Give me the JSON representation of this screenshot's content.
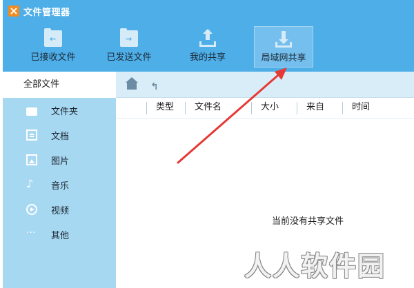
{
  "app": {
    "title": "文件管理器"
  },
  "toolbar": {
    "items": [
      {
        "label": "已接收文件",
        "icon": "received-folder-icon"
      },
      {
        "label": "已发送文件",
        "icon": "sent-folder-icon"
      },
      {
        "label": "我的共享",
        "icon": "upload-share-icon"
      },
      {
        "label": "局域网共享",
        "icon": "download-share-icon",
        "active": true
      }
    ]
  },
  "sidebar": {
    "all_label": "全部文件",
    "items": [
      {
        "label": "文件夹",
        "icon": "folder-icon"
      },
      {
        "label": "文档",
        "icon": "document-icon"
      },
      {
        "label": "图片",
        "icon": "image-icon"
      },
      {
        "label": "音乐",
        "icon": "music-icon"
      },
      {
        "label": "视频",
        "icon": "video-icon"
      },
      {
        "label": "其他",
        "icon": "more-icon"
      }
    ]
  },
  "table": {
    "columns": [
      "类型",
      "文件名",
      "大小",
      "来自",
      "时间"
    ]
  },
  "main": {
    "empty_text": "当前没有共享文件"
  },
  "watermark": {
    "text": "人人软件园"
  },
  "colors": {
    "toolbar_bg": "#4eaee8",
    "sidebar_bg": "#a7d8f2",
    "pathbar_bg": "#d9edf8",
    "annotation_arrow": "#e53935"
  }
}
